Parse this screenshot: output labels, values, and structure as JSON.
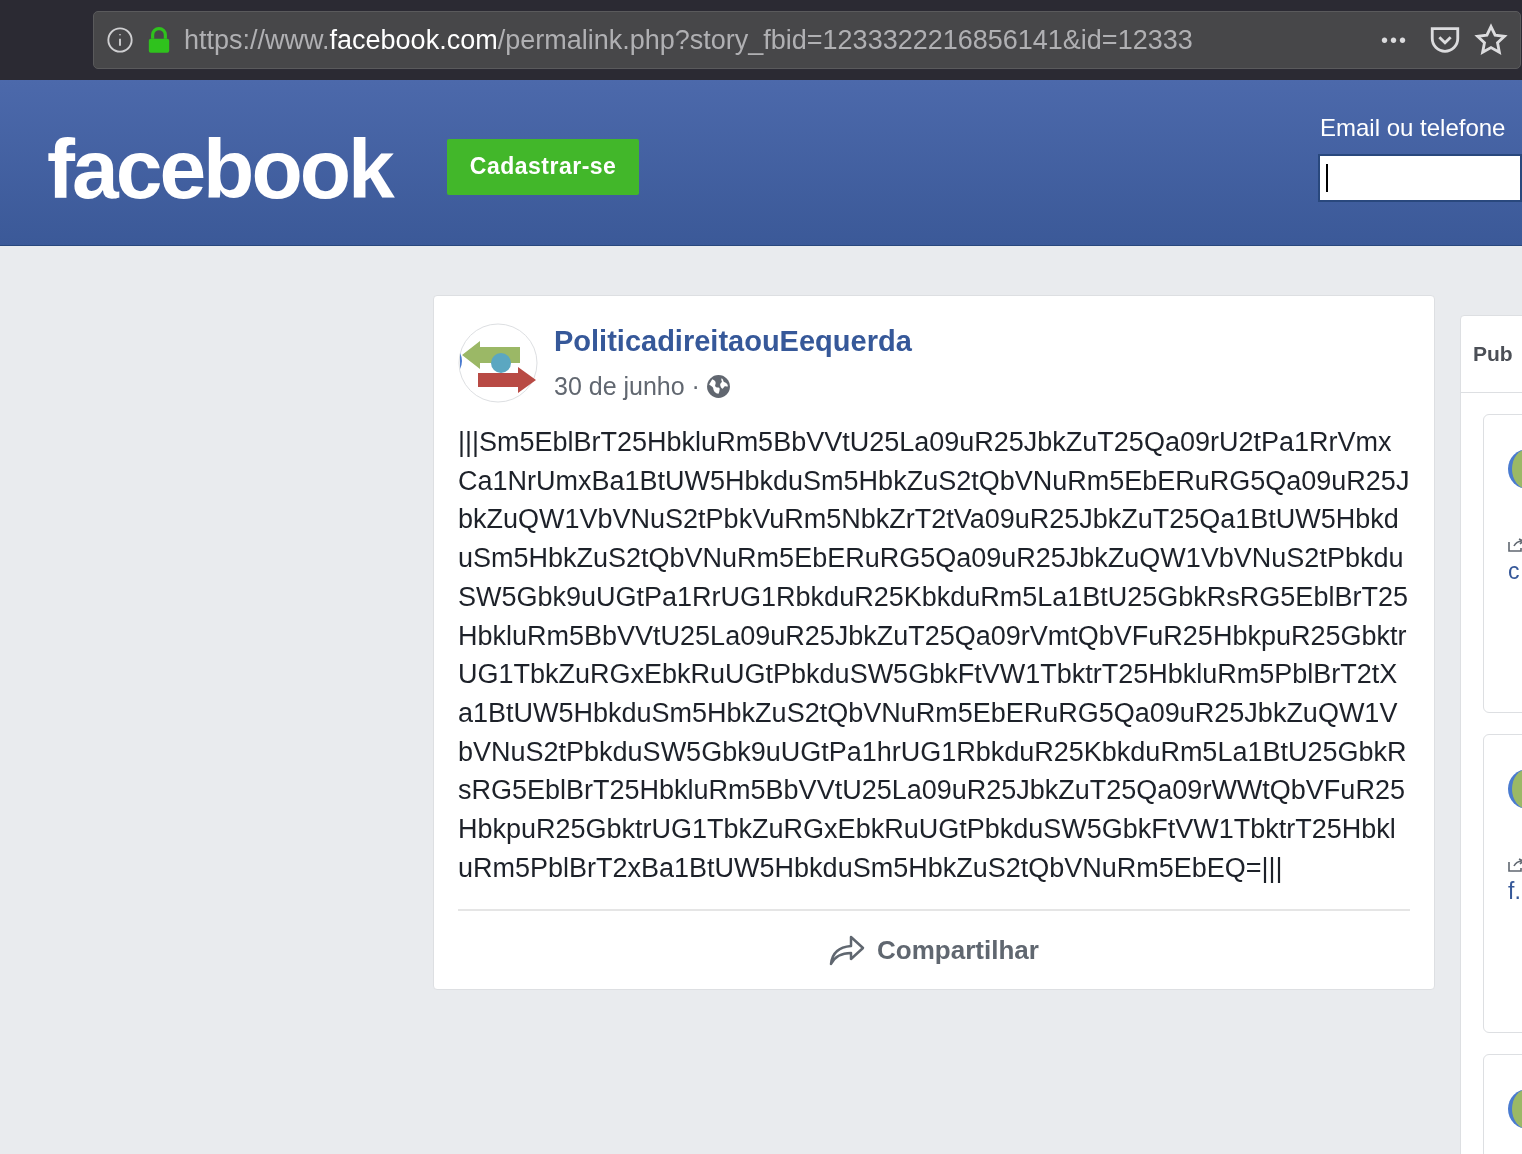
{
  "browser": {
    "url": {
      "prefix": "https://www.",
      "host": "facebook.com",
      "path": "/permalink.php?story_fbid=1233322216856141&id=12333"
    },
    "more": "•••"
  },
  "header": {
    "logo": "facebook",
    "signup_button": "Cadastrar-se",
    "login": {
      "label": "Email ou telefone"
    }
  },
  "post": {
    "author": "PoliticadireitaouEequerda",
    "date": "30 de junho ·",
    "text": "|||Sm5EblBrT25HbkluRm5BbVVtU25La09uR25JbkZuT25Qa09rU2tPa1RrVmxCa1NrUmxBa1BtUW5HbkduSm5HbkZuS2tQbVNuRm5EbERuRG5Qa09uR25JbkZuQW1VbVNuS2tPbkVuRm5NbkZrT2tVa09uR25JbkZuT25Qa1BtUW5HbkduSm5HbkZuS2tQbVNuRm5EbERuRG5Qa09uR25JbkZuQW1VbVNuS2tPbkduSW5Gbk9uUGtPa1RrUG1RbkduR25KbkduRm5La1BtU25GbkRsRG5EblBrT25HbkluRm5BbVVtU25La09uR25JbkZuT25Qa09rVmtQbVFuR25HbkpuR25GbktrUG1TbkZuRGxEbkRuUGtPbkduSW5GbkFtVW1TbktrT25HbkluRm5PblBrT2tXa1BtUW5HbkduSm5HbkZuS2tQbVNuRm5EbERuRG5Qa09uR25JbkZuQW1VbVNuS2tPbkduSW5Gbk9uUGtPa1hrUG1RbkduR25KbkduRm5La1BtU25GbkRsRG5EblBrT25HbkluRm5BbVVtU25La09uR25JbkZuT25Qa09rWWtQbVFuR25HbkpuR25GbktrUG1TbkZuRGxEbkRuUGtPbkduSW5GbkFtVW1TbktrT25HbkluRm5PblBrT2xBa1BtUW5HbkduSm5HbkZuS2tQbVNuRm5EbEQ=|||",
    "share": "Compartilhar"
  },
  "sidebar": {
    "title": "Pub",
    "cards": [
      {
        "kind": "link",
        "text": "c"
      },
      {
        "kind": "link",
        "text": "f."
      },
      {
        "kind": "avatar"
      }
    ]
  }
}
